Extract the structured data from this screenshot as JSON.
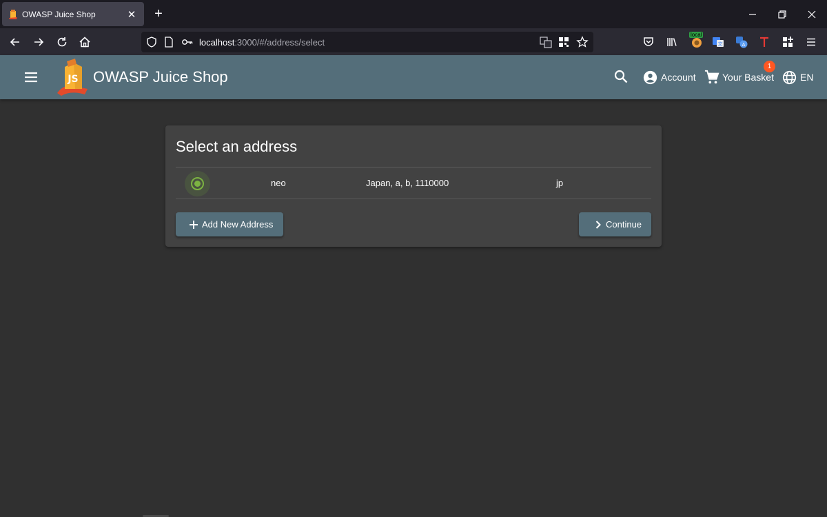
{
  "browser": {
    "tab_title": "OWASP Juice Shop",
    "url_host": "localhost",
    "url_path": ":3000/#/address/select",
    "ext_local_label": "local"
  },
  "app": {
    "title": "OWASP Juice Shop",
    "logo_text": "JS",
    "account_label": "Account",
    "basket_label": "Your Basket",
    "basket_count": "1",
    "language_label": "EN"
  },
  "address_select": {
    "heading": "Select an address",
    "addresses": [
      {
        "name": "neo",
        "address": "Japan, a, b, 1110000",
        "country": "jp",
        "selected": true
      }
    ],
    "add_button_label": "Add New Address",
    "continue_button_label": "Continue"
  },
  "colors": {
    "toolbar": "#546e7a",
    "page_background": "#303030",
    "card_background": "#424242",
    "radio_accent": "#7cb342",
    "badge": "#ff5722"
  }
}
